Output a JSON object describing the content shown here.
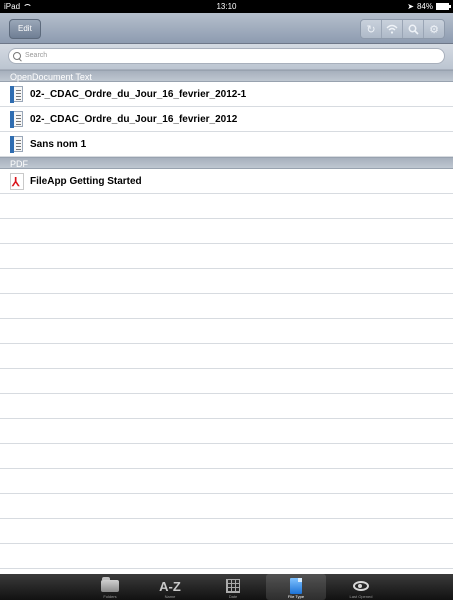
{
  "status": {
    "device": "iPad",
    "time": "13:10",
    "battery": "84%"
  },
  "toolbar": {
    "edit_label": "Edit",
    "icons": [
      "refresh-icon",
      "wifi-icon",
      "search-icon",
      "gear-icon"
    ]
  },
  "search": {
    "placeholder": "Search"
  },
  "sections": [
    {
      "title": "OpenDocument Text",
      "items": [
        {
          "name": "02-_CDAC_Ordre_du_Jour_16_fevrier_2012-1",
          "icon": "odt-file-icon"
        },
        {
          "name": "02-_CDAC_Ordre_du_Jour_16_fevrier_2012",
          "icon": "odt-file-icon"
        },
        {
          "name": "Sans nom 1",
          "icon": "odt-file-icon"
        }
      ]
    },
    {
      "title": "PDF",
      "items": [
        {
          "name": "FileApp Getting Started",
          "icon": "pdf-file-icon"
        }
      ]
    }
  ],
  "tabbar": {
    "tabs": [
      {
        "label": "Folders",
        "icon": "folder-icon"
      },
      {
        "label": "Name",
        "icon": "a-z-icon",
        "glyph": "A-Z"
      },
      {
        "label": "Date",
        "icon": "calendar-icon"
      },
      {
        "label": "File Type",
        "icon": "file-type-icon",
        "selected": true
      },
      {
        "label": "Last Opened",
        "icon": "eye-icon"
      }
    ]
  }
}
